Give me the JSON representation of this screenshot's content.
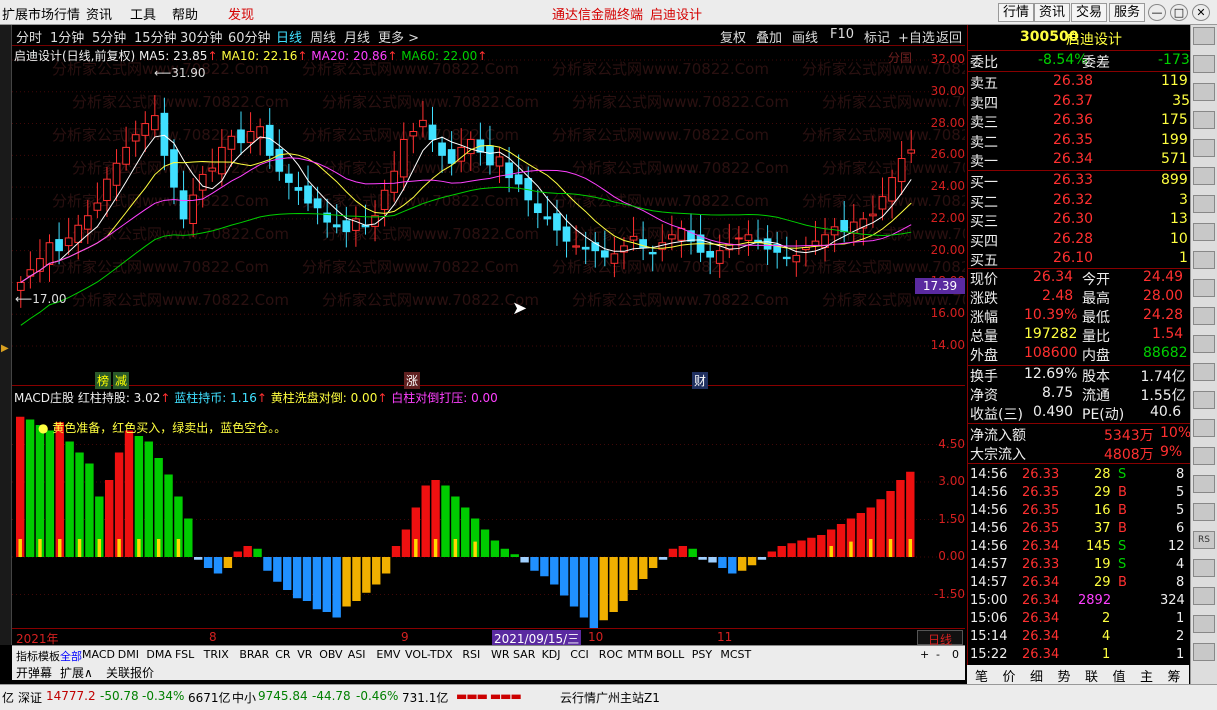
{
  "menubar": {
    "items": [
      "扩展市场行情",
      "资讯",
      "工具",
      "帮助",
      "发现"
    ],
    "center_left": "通达信金融终端",
    "center_right": "启迪设计",
    "right_buttons": [
      "行情",
      "资讯",
      "交易",
      "服务"
    ]
  },
  "toolbar": {
    "periods": [
      "分时",
      "1分钟",
      "5分钟",
      "15分钟",
      "30分钟",
      "60分钟",
      "日线",
      "周线",
      "月线",
      "更多 >"
    ],
    "active_period": "日线",
    "actions": [
      "复权",
      "叠加",
      "画线",
      "F10",
      "标记",
      "+自选",
      "返回"
    ],
    "watermark_small": "分国"
  },
  "kchart": {
    "legend_title": "启迪设计(日线,前复权)",
    "ma5": "MA5: 23.85",
    "ma10": "MA10: 22.16",
    "ma20": "MA20: 20.86",
    "ma60": "MA60: 22.00",
    "high_label": "31.90",
    "low_label": "17.00",
    "y_ticks": [
      "32.00",
      "30.00",
      "28.00",
      "26.00",
      "24.00",
      "22.00",
      "20.00",
      "18.00",
      "16.00",
      "14.00"
    ],
    "current_price_tag": "17.39",
    "badges": [
      "榜",
      "减",
      "涨",
      "财"
    ]
  },
  "macd": {
    "title": "MACD庄股",
    "red": "红柱持股: 3.02",
    "blue": "蓝柱持币: 1.16",
    "yellow": "黄柱洗盘对倒: 0.00",
    "white": "白柱对倒打压: 0.00",
    "note": "● 黄色准备，红色买入，绿卖出，蓝色空仓。。",
    "y_ticks": [
      "4.50",
      "3.00",
      "1.50",
      "0.00",
      "-1.50"
    ]
  },
  "xaxis": {
    "labels": [
      "2021年",
      "8",
      "9",
      "2021/09/15/三",
      "10",
      "11"
    ],
    "period_box": "日线"
  },
  "watermark": "分析家公式网www.70822.Com",
  "indicator_tabs": [
    "指标",
    "模板",
    "全部",
    "MACD",
    "DMI",
    "DMA",
    "FSL",
    "TRIX",
    "BRAR",
    "CR",
    "VR",
    "OBV",
    "ASI",
    "EMV",
    "VOL-TDX",
    "RSI",
    "WR",
    "SAR",
    "KDJ",
    "CCI",
    "ROC",
    "MTM",
    "BOLL",
    "PSY",
    "MCST"
  ],
  "indicator_tabs_right": [
    "+",
    "-",
    "0"
  ],
  "bottom_tabs": [
    "开弹幕",
    "扩展∧",
    "关联报价"
  ],
  "status": {
    "a": "亿",
    "sz_name": "深证",
    "sz_val": "14777.2",
    "sz_chg": "-50.78",
    "sz_pct": "-0.34%",
    "sz_amt": "6671亿",
    "zx_name": "中小",
    "zx_val": "9745.84",
    "zx_chg": "-44.78",
    "zx_pct": "-0.46%",
    "zx_amt": "731.1亿",
    "server": "云行情广州主站Z1"
  },
  "quote": {
    "code": "300500",
    "name": "启迪设计",
    "weibi_label": "委比",
    "weibi": "-8.54%",
    "weicha_label": "委差",
    "weicha": "-173",
    "sells": [
      {
        "label": "卖五",
        "price": "26.38",
        "vol": "119"
      },
      {
        "label": "卖四",
        "price": "26.37",
        "vol": "35"
      },
      {
        "label": "卖三",
        "price": "26.36",
        "vol": "175"
      },
      {
        "label": "卖二",
        "price": "26.35",
        "vol": "199"
      },
      {
        "label": "卖一",
        "price": "26.34",
        "vol": "571"
      }
    ],
    "buys": [
      {
        "label": "买一",
        "price": "26.33",
        "vol": "899"
      },
      {
        "label": "买二",
        "price": "26.32",
        "vol": "3"
      },
      {
        "label": "买三",
        "price": "26.30",
        "vol": "13"
      },
      {
        "label": "买四",
        "price": "26.28",
        "vol": "10"
      },
      {
        "label": "买五",
        "price": "26.10",
        "vol": "1"
      }
    ],
    "stats": [
      {
        "l1": "现价",
        "v1": "26.34",
        "l2": "今开",
        "v2": "24.49",
        "c1": "red",
        "c2": "red"
      },
      {
        "l1": "涨跌",
        "v1": "2.48",
        "l2": "最高",
        "v2": "28.00",
        "c1": "red",
        "c2": "red"
      },
      {
        "l1": "涨幅",
        "v1": "10.39%",
        "l2": "最低",
        "v2": "24.28",
        "c1": "red",
        "c2": "red"
      },
      {
        "l1": "总量",
        "v1": "197282",
        "l2": "量比",
        "v2": "1.54",
        "c1": "yellow",
        "c2": "red"
      },
      {
        "l1": "外盘",
        "v1": "108600",
        "l2": "内盘",
        "v2": "88682",
        "c1": "red",
        "c2": "green"
      }
    ],
    "fin": [
      {
        "l1": "换手",
        "v1": "12.69%",
        "l2": "股本",
        "v2": "1.74亿"
      },
      {
        "l1": "净资",
        "v1": "8.75",
        "l2": "流通",
        "v2": "1.55亿"
      },
      {
        "l1": "收益(三)",
        "v1": "0.490",
        "l2": "PE(动)",
        "v2": "40.6"
      }
    ],
    "flow": [
      {
        "label": "净流入额",
        "val": "5343万",
        "pct": "10%"
      },
      {
        "label": "大宗流入",
        "val": "4808万",
        "pct": "9%"
      }
    ],
    "ticks": [
      {
        "t": "14:56",
        "p": "26.33",
        "v": "28",
        "d": "S",
        "n": "8"
      },
      {
        "t": "14:56",
        "p": "26.35",
        "v": "29",
        "d": "B",
        "n": "5"
      },
      {
        "t": "14:56",
        "p": "26.35",
        "v": "16",
        "d": "B",
        "n": "5"
      },
      {
        "t": "14:56",
        "p": "26.35",
        "v": "37",
        "d": "B",
        "n": "6"
      },
      {
        "t": "14:56",
        "p": "26.34",
        "v": "145",
        "d": "S",
        "n": "12"
      },
      {
        "t": "14:57",
        "p": "26.33",
        "v": "19",
        "d": "S",
        "n": "4"
      },
      {
        "t": "14:57",
        "p": "26.34",
        "v": "29",
        "d": "B",
        "n": "8"
      },
      {
        "t": "15:00",
        "p": "26.34",
        "v": "2892",
        "d": "",
        "n": "324"
      },
      {
        "t": "15:06",
        "p": "26.34",
        "v": "2",
        "d": "",
        "n": "1"
      },
      {
        "t": "15:14",
        "p": "26.34",
        "v": "4",
        "d": "",
        "n": "2"
      },
      {
        "t": "15:22",
        "p": "26.34",
        "v": "1",
        "d": "",
        "n": "1"
      }
    ]
  },
  "right_tabs": [
    "笔",
    "价",
    "细",
    "势",
    "联",
    "值",
    "主",
    "筹"
  ],
  "right_icons": [
    "",
    "",
    "",
    "",
    "",
    "",
    "",
    "",
    "",
    "",
    "",
    "",
    "",
    "",
    "",
    "",
    "",
    "",
    "RS",
    "",
    "",
    "",
    ""
  ]
}
